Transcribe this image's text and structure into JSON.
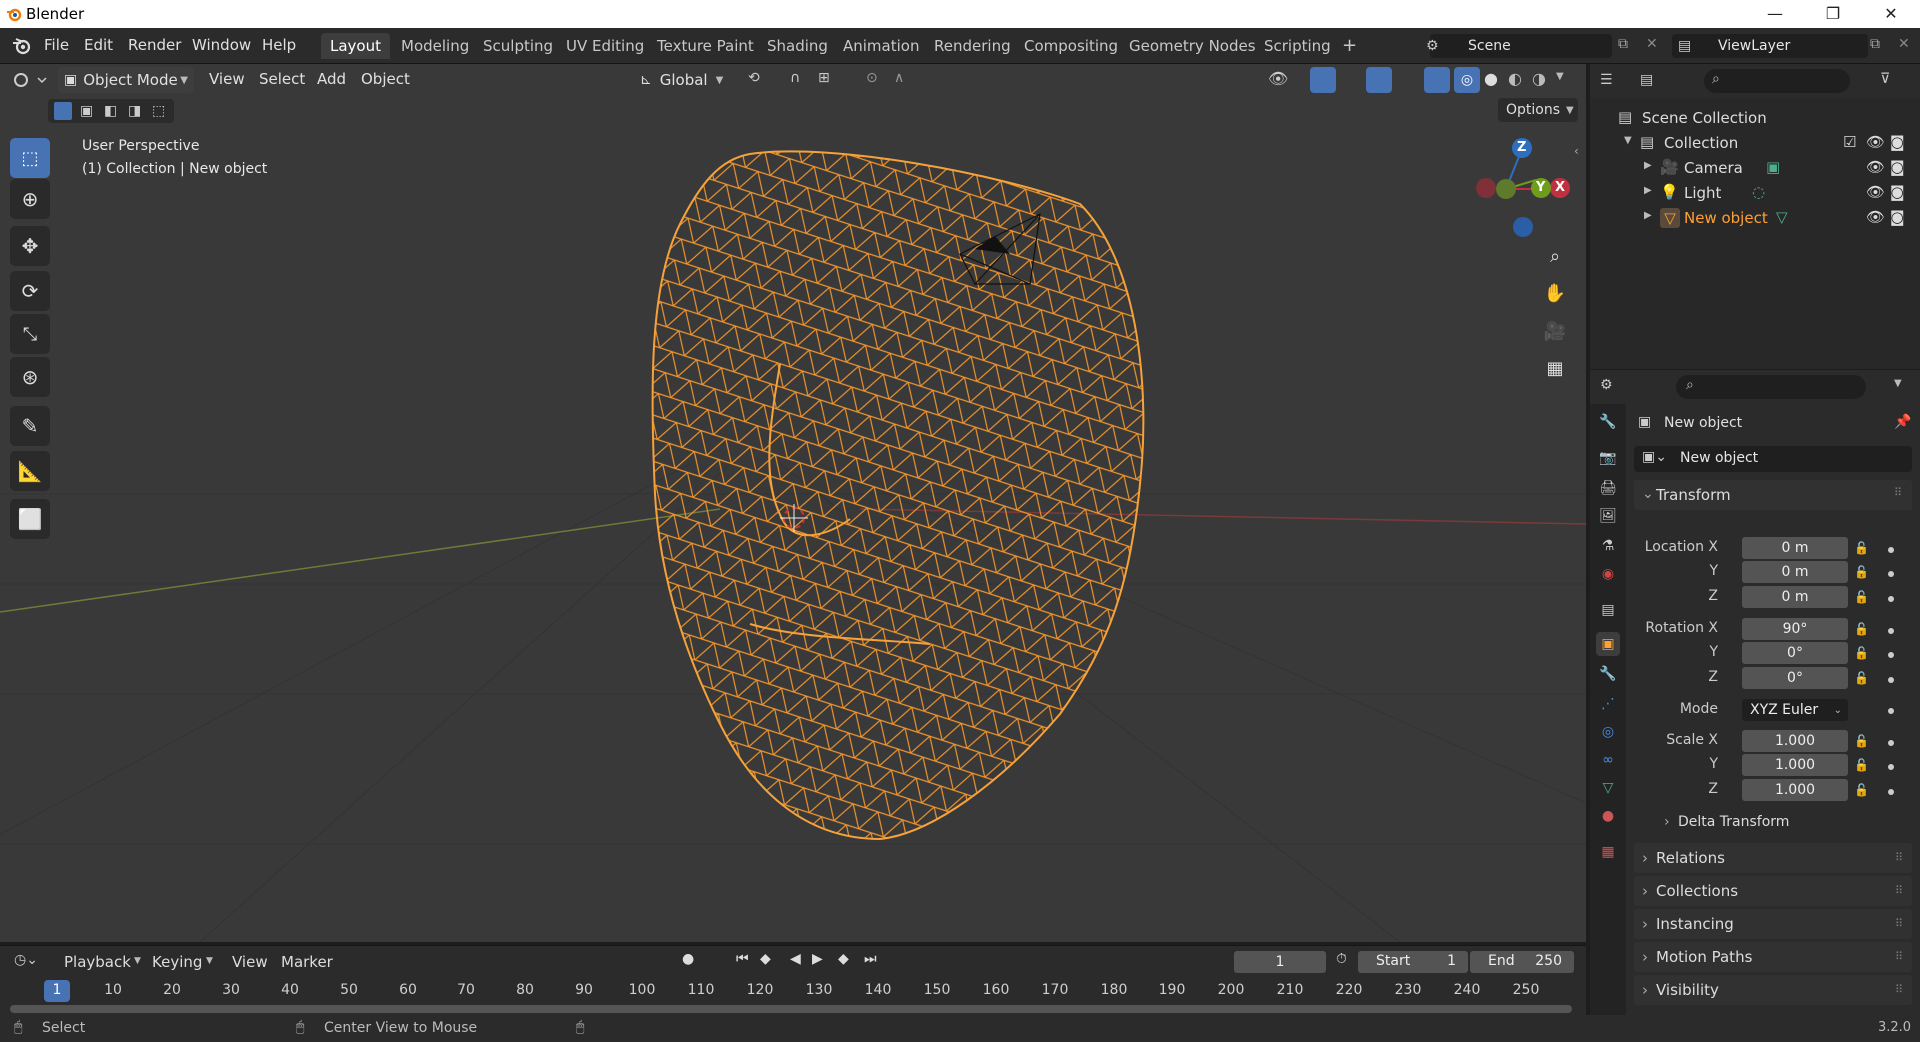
{
  "window": {
    "title": "Blender",
    "minimize": "—",
    "maximize": "❐",
    "close": "✕"
  },
  "menus": [
    "File",
    "Edit",
    "Render",
    "Window",
    "Help"
  ],
  "workspaces": [
    "Layout",
    "Modeling",
    "Sculpting",
    "UV Editing",
    "Texture Paint",
    "Shading",
    "Animation",
    "Rendering",
    "Compositing",
    "Geometry Nodes",
    "Scripting"
  ],
  "workspace_add": "+",
  "scene": {
    "name": "Scene",
    "view_layer": "ViewLayer"
  },
  "viewport_header": {
    "mode": "Object Mode",
    "menus": [
      "View",
      "Select",
      "Add",
      "Object"
    ],
    "orientation": "Global",
    "options": "Options"
  },
  "viewport_info": {
    "line1": "User Perspective",
    "line2": "(1) Collection | New object"
  },
  "gizmo": {
    "z": "Z",
    "y": "Y",
    "x": "X"
  },
  "outliner": {
    "root": "Scene Collection",
    "collection": "Collection",
    "items": [
      "Camera",
      "Light",
      "New object"
    ]
  },
  "properties": {
    "object_name": "New object",
    "datablock": "New object",
    "transform_title": "Transform",
    "location": {
      "label": "Location X",
      "x": "0 m",
      "y": "0 m",
      "z": "0 m"
    },
    "rotation": {
      "label": "Rotation X",
      "x": "90°",
      "y": "0°",
      "z": "0°"
    },
    "mode": {
      "label": "Mode",
      "value": "XYZ Euler"
    },
    "scale": {
      "label": "Scale X",
      "x": "1.000",
      "y": "1.000",
      "z": "1.000"
    },
    "axis_y": "Y",
    "axis_z": "Z",
    "panels": [
      "Delta Transform",
      "Relations",
      "Collections",
      "Instancing",
      "Motion Paths",
      "Visibility"
    ]
  },
  "timeline": {
    "menus": [
      "Playback",
      "Keying",
      "View",
      "Marker"
    ],
    "current_frame": "1",
    "start_label": "Start",
    "start": "1",
    "end_label": "End",
    "end": "250",
    "ticks": [
      "1",
      "10",
      "20",
      "30",
      "40",
      "50",
      "60",
      "70",
      "80",
      "90",
      "100",
      "110",
      "120",
      "130",
      "140",
      "150",
      "160",
      "170",
      "180",
      "190",
      "200",
      "210",
      "220",
      "230",
      "240",
      "250"
    ]
  },
  "status": {
    "select": "Select",
    "center": "Center View to Mouse",
    "version": "3.2.0"
  },
  "colors": {
    "accent": "#4772b3",
    "selected_orange": "#ffa033",
    "wire": "#f0952e"
  }
}
